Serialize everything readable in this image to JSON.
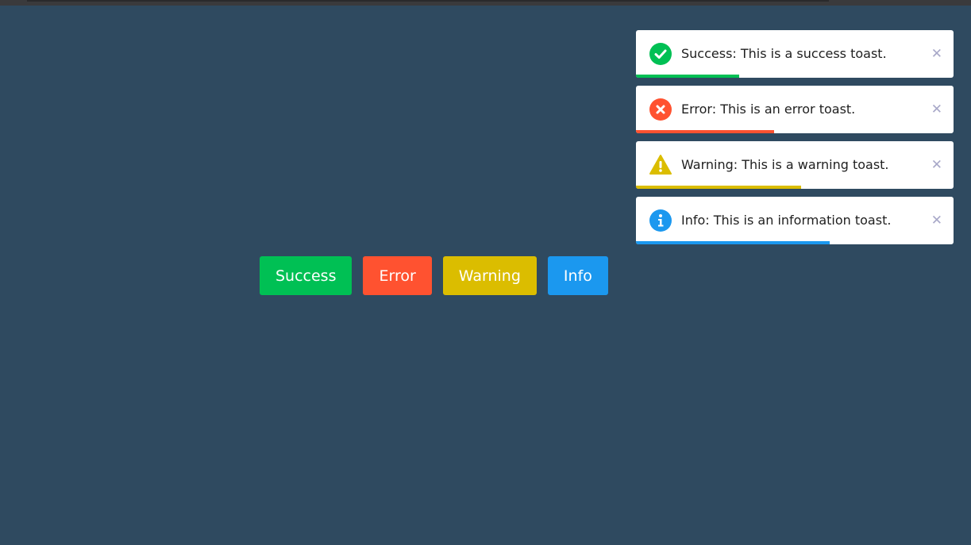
{
  "colors": {
    "background": "#2f4a60",
    "success": "#00c054",
    "error": "#ff5230",
    "warning": "#dbbd00",
    "info": "#1b98ef"
  },
  "buttons": [
    {
      "label": "Success",
      "color": "#00c054"
    },
    {
      "label": "Error",
      "color": "#ff5230"
    },
    {
      "label": "Warning",
      "color": "#dbbd00"
    },
    {
      "label": "Info",
      "color": "#1b98ef"
    }
  ],
  "toasts": [
    {
      "type": "success",
      "icon": "check-circle-icon",
      "message": "Success: This is a success toast.",
      "close": "✕",
      "progress": 0.325,
      "color": "#00c054"
    },
    {
      "type": "error",
      "icon": "x-circle-icon",
      "message": "Error: This is an error toast.",
      "close": "✕",
      "progress": 0.435,
      "color": "#ff5230"
    },
    {
      "type": "warning",
      "icon": "warning-triangle-icon",
      "message": "Warning: This is a warning toast.",
      "close": "✕",
      "progress": 0.52,
      "color": "#dbbd00"
    },
    {
      "type": "info",
      "icon": "info-circle-icon",
      "message": "Info: This is an information toast.",
      "close": "✕",
      "progress": 0.61,
      "color": "#1b98ef"
    }
  ]
}
